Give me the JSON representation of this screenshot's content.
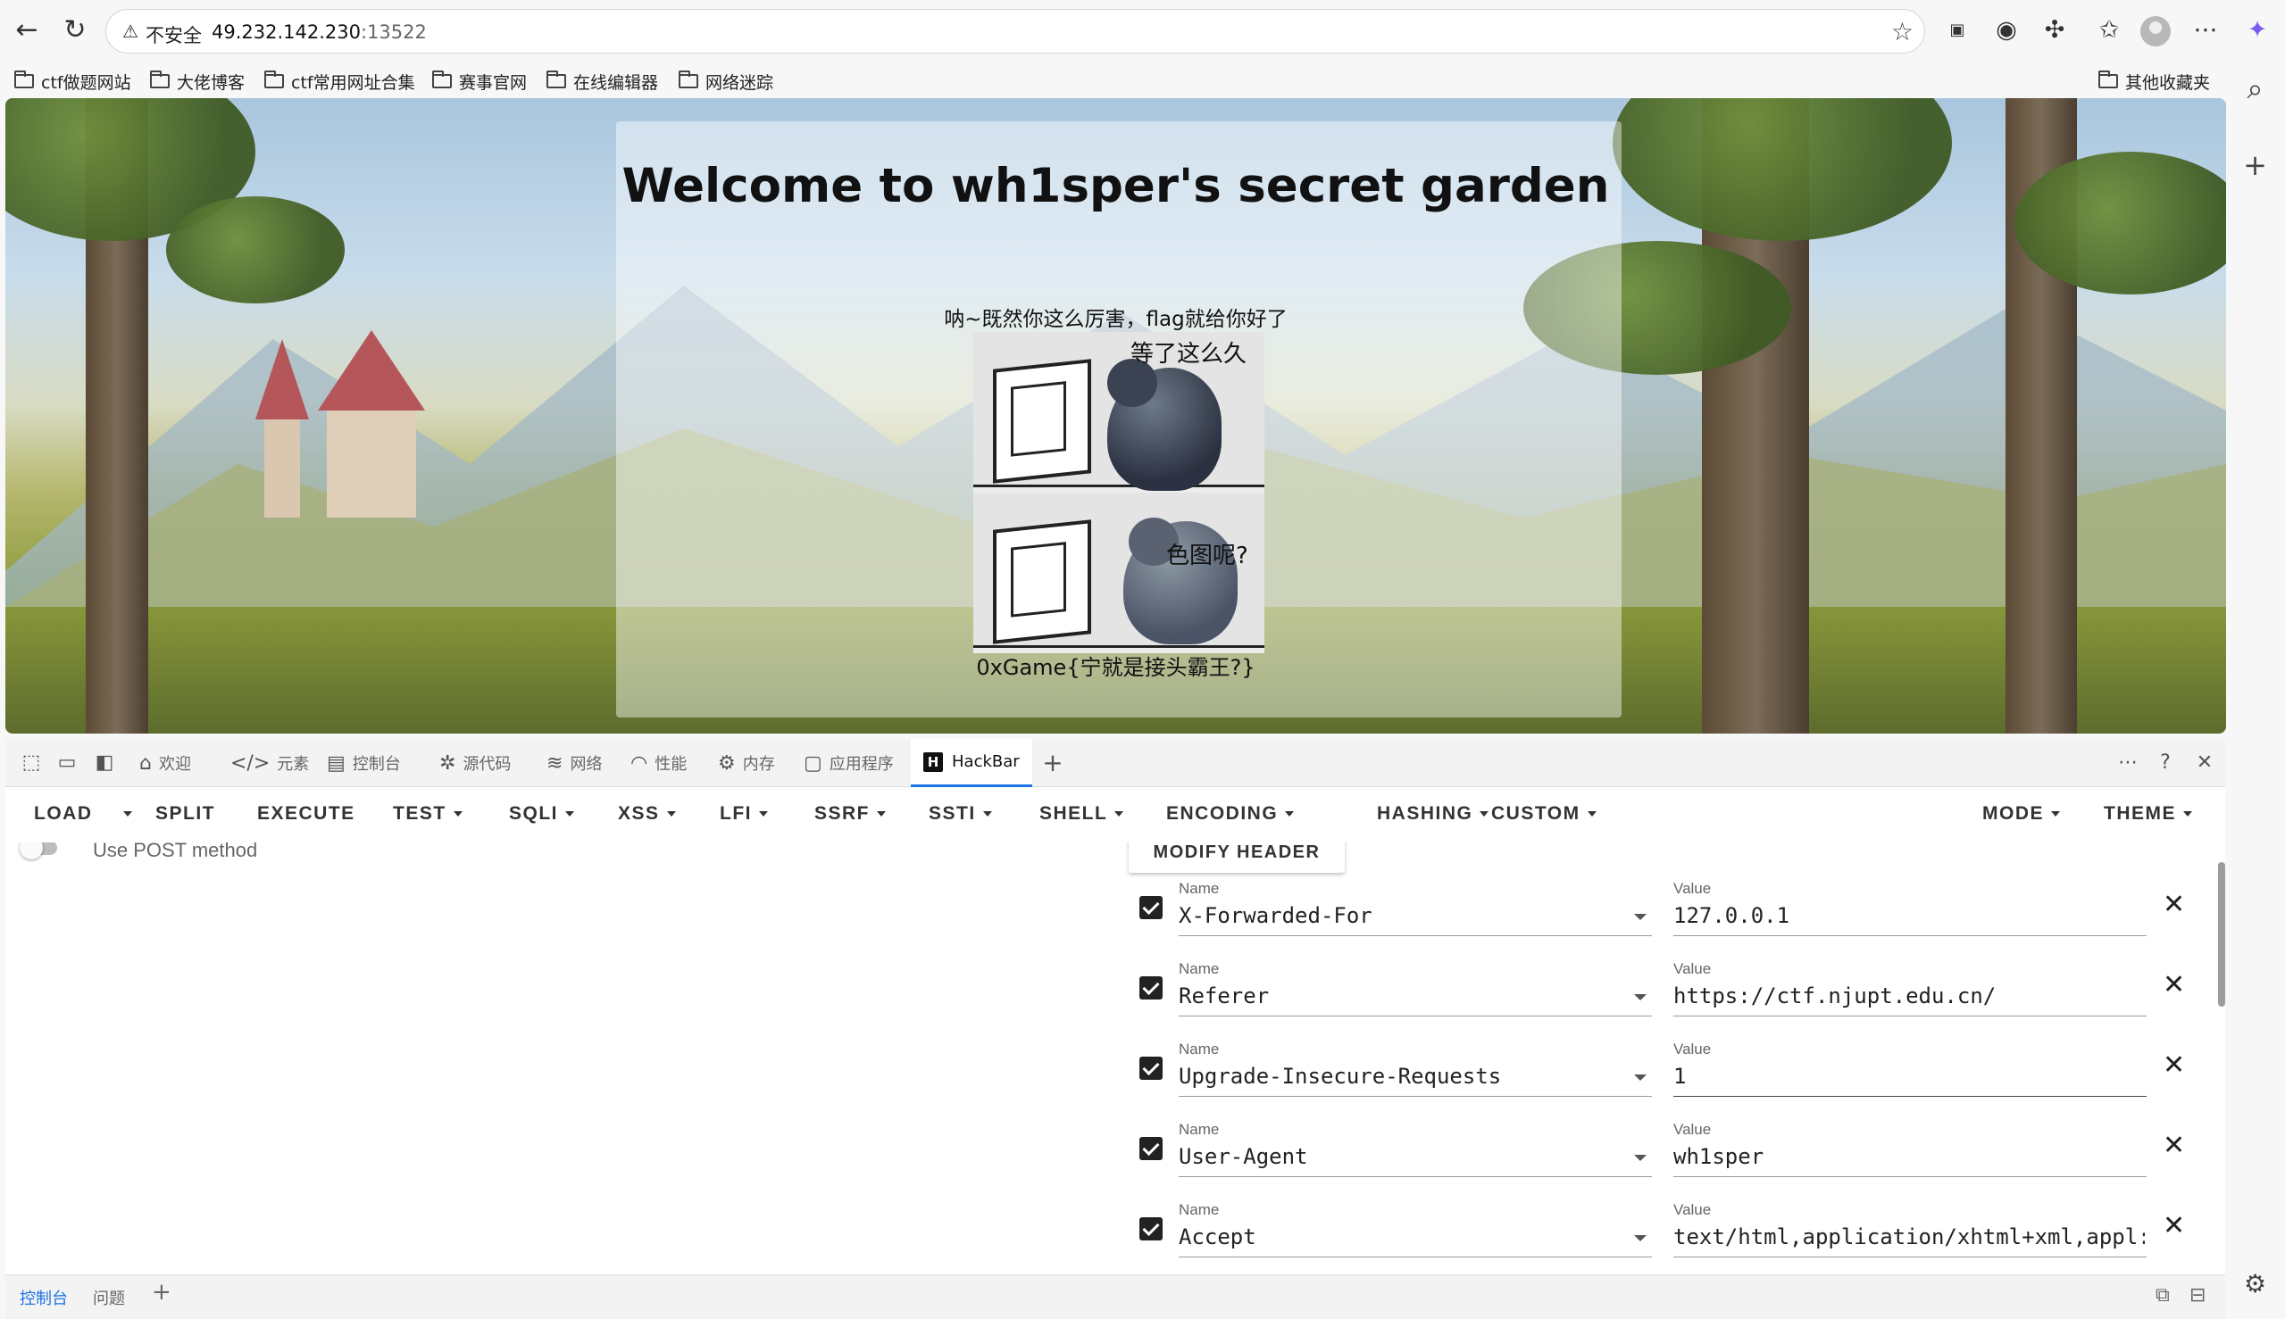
{
  "browser": {
    "url_warning": "不安全",
    "url_host": "49.232.142.230",
    "url_port": ":13522",
    "bookmarks": [
      "ctf做题网站",
      "大佬博客",
      "ctf常用网址合集",
      "赛事官网",
      "在线编辑器",
      "网络迷踪"
    ],
    "other_bookmarks": "其他收藏夹"
  },
  "page": {
    "title": "Welcome to wh1sper's secret garden",
    "message": "呐~既然你这么厉害，flag就给你好了",
    "meme_caption_top": "等了这么久",
    "meme_caption_bottom": "色图呢?",
    "flag": "0xGame{宁就是接头霸王?}"
  },
  "devtools": {
    "tabs": [
      {
        "label": "欢迎",
        "icon": "home-icon"
      },
      {
        "label": "元素",
        "icon": "code-icon"
      },
      {
        "label": "控制台",
        "icon": "console-icon"
      },
      {
        "label": "源代码",
        "icon": "bug-icon"
      },
      {
        "label": "网络",
        "icon": "wifi-icon"
      },
      {
        "label": "性能",
        "icon": "gauge-icon"
      },
      {
        "label": "内存",
        "icon": "chip-icon"
      },
      {
        "label": "应用程序",
        "icon": "app-icon"
      },
      {
        "label": "HackBar",
        "icon": "hackbar-logo"
      }
    ],
    "active_tab": "HackBar",
    "drawer_tabs": [
      "控制台",
      "问题"
    ]
  },
  "hackbar": {
    "menu": {
      "load": "LOAD",
      "split": "SPLIT",
      "execute": "EXECUTE",
      "test": "TEST",
      "sqli": "SQLI",
      "xss": "XSS",
      "lfi": "LFI",
      "ssrf": "SSRF",
      "ssti": "SSTI",
      "shell": "SHELL",
      "encoding": "ENCODING",
      "hashing": "HASHING",
      "custom": "CUSTOM",
      "mode": "MODE",
      "theme": "THEME"
    },
    "post_toggle_label": "Use POST method",
    "post_enabled": false,
    "modify_header_label": "MODIFY HEADER",
    "name_label": "Name",
    "value_label": "Value",
    "headers": [
      {
        "name": "X-Forwarded-For",
        "value": "127.0.0.1",
        "enabled": true
      },
      {
        "name": "Referer",
        "value": "https://ctf.njupt.edu.cn/",
        "enabled": true
      },
      {
        "name": "Upgrade-Insecure-Requests",
        "value": "1",
        "enabled": true
      },
      {
        "name": "User-Agent",
        "value": "wh1sper",
        "enabled": true
      },
      {
        "name": "Accept",
        "value": "text/html,application/xhtml+xml,appl:",
        "enabled": true
      }
    ]
  },
  "colors": {
    "accent": "#1a73e8",
    "checkbox": "#222222"
  }
}
